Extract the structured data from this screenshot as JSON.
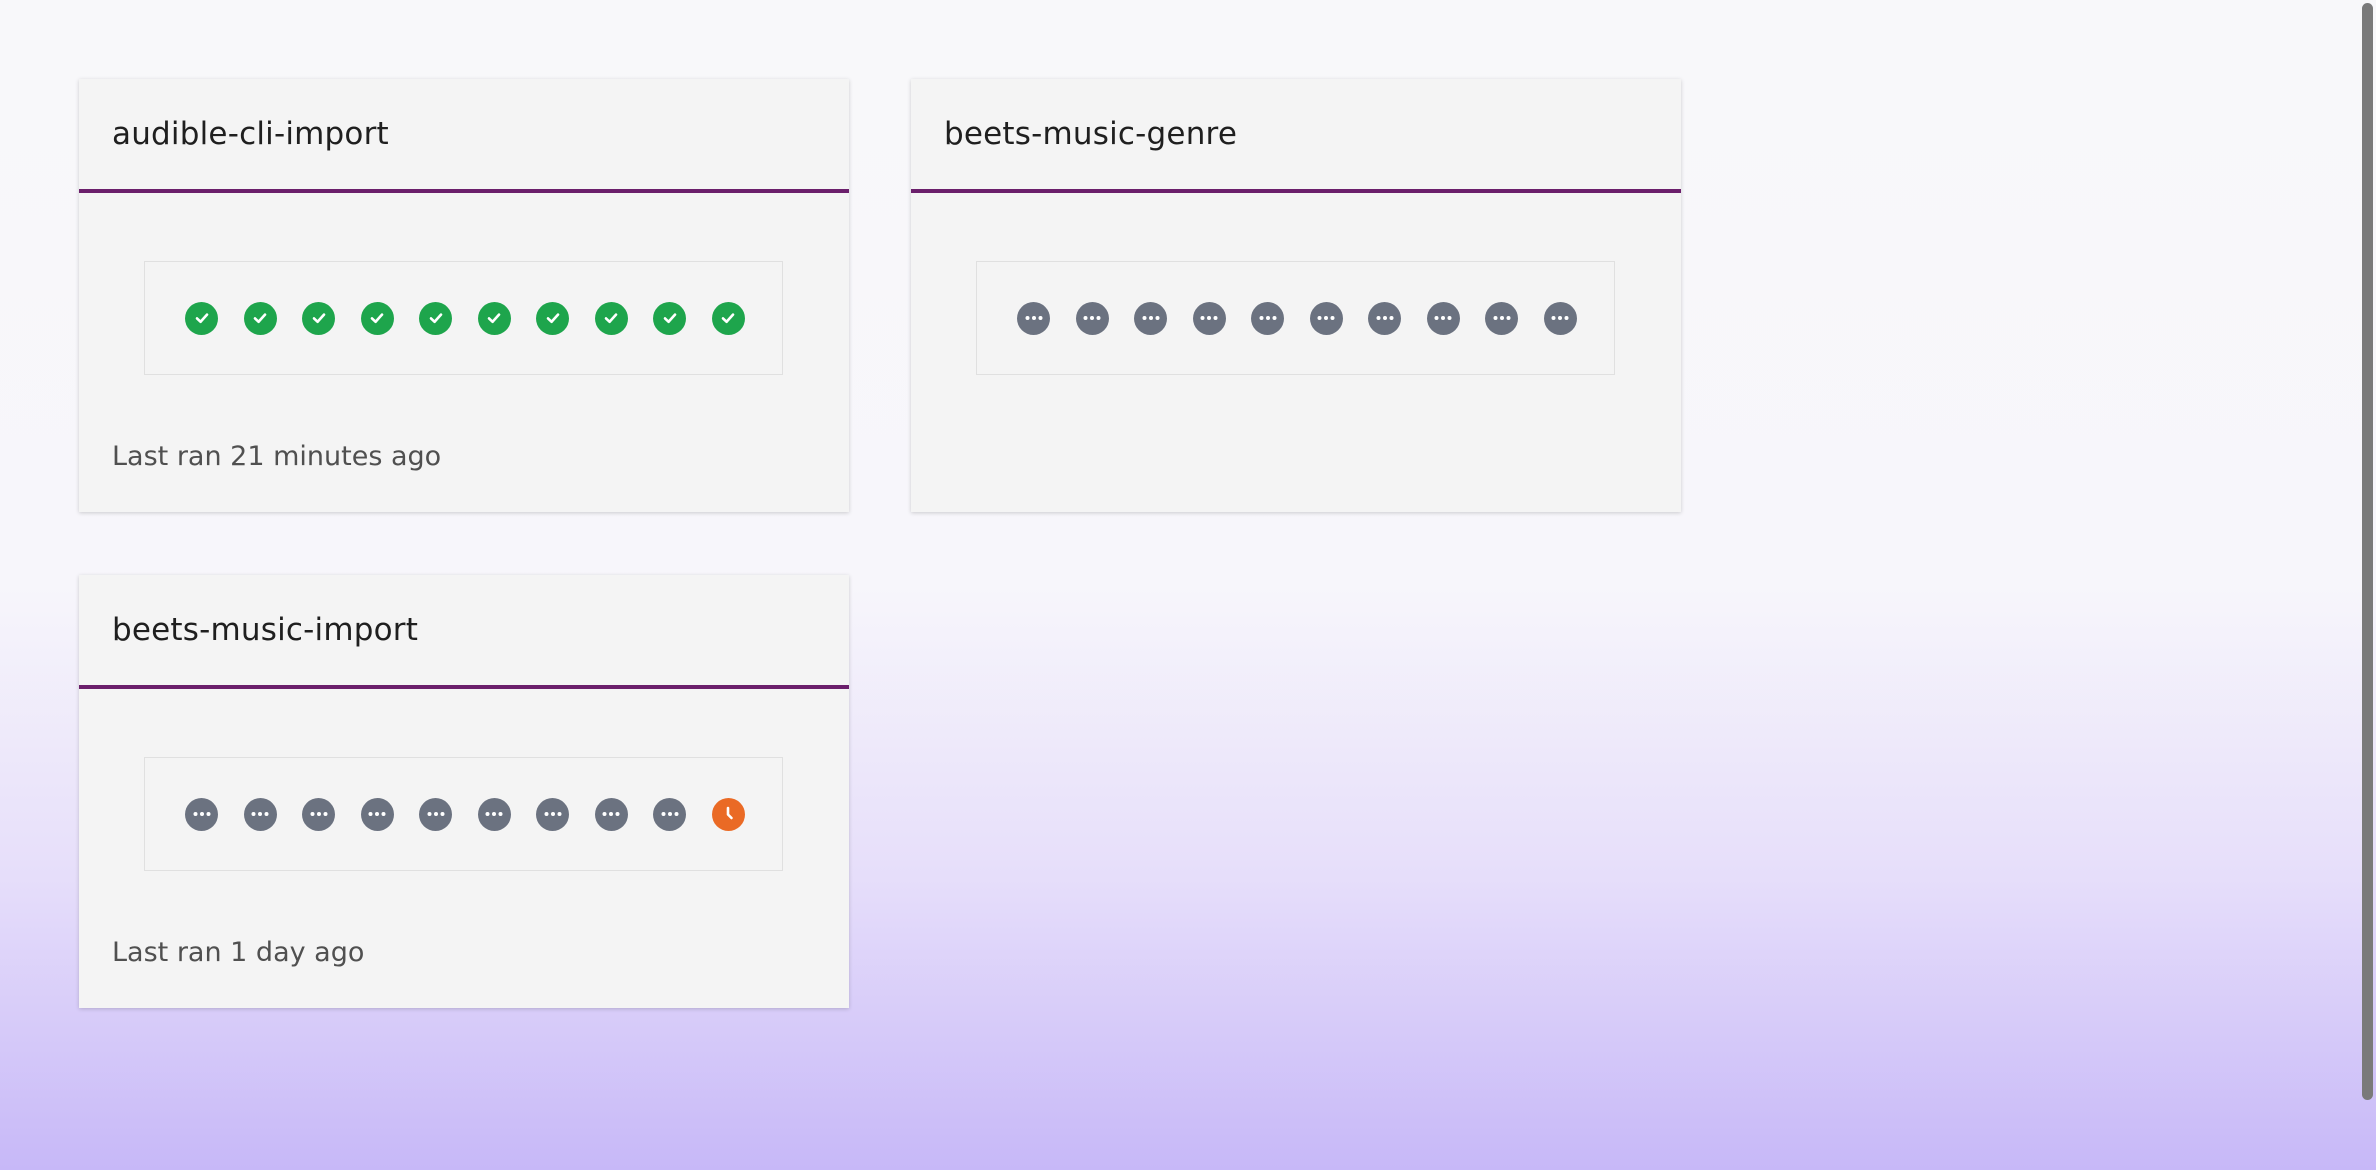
{
  "colors": {
    "accent_border": "#6b1f6b",
    "success": "#1ea54c",
    "pending": "#6b7280",
    "running": "#ea6a25"
  },
  "jobs": [
    {
      "title": "audible-cli-import",
      "runs": [
        "success",
        "success",
        "success",
        "success",
        "success",
        "success",
        "success",
        "success",
        "success",
        "success"
      ],
      "last_ran": "Last ran 21 minutes ago"
    },
    {
      "title": "beets-music-genre",
      "runs": [
        "pending",
        "pending",
        "pending",
        "pending",
        "pending",
        "pending",
        "pending",
        "pending",
        "pending",
        "pending"
      ],
      "last_ran": ""
    },
    {
      "title": "beets-music-import",
      "runs": [
        "pending",
        "pending",
        "pending",
        "pending",
        "pending",
        "pending",
        "pending",
        "pending",
        "pending",
        "running"
      ],
      "last_ran": "Last ran 1 day ago"
    }
  ],
  "icons": {
    "success": "check-circle-icon",
    "pending": "ellipsis-circle-icon",
    "running": "clock-icon"
  }
}
